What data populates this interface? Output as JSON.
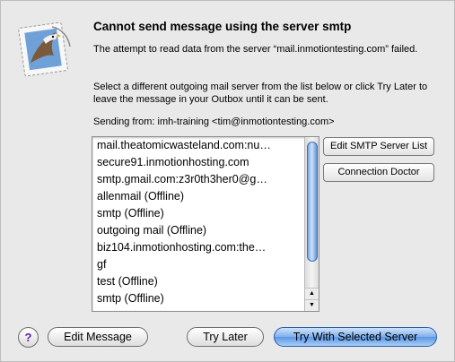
{
  "dialog": {
    "title": "Cannot send message using the server smtp",
    "paragraph1": "The attempt to read data from the server “mail.inmotiontesting.com” failed.",
    "paragraph2": "Select a different outgoing mail server from the list below or click Try Later to leave the message in your Outbox until it can be sent.",
    "sending_from": "Sending from: imh-training <tim@inmotiontesting.com>"
  },
  "servers": [
    "mail.theatomicwasteland.com:nu…",
    "secure91.inmotionhosting.com",
    "smtp.gmail.com:z3r0th3her0@g…",
    "allenmail (Offline)",
    "smtp (Offline)",
    "outgoing mail (Offline)",
    "biz104.inmotionhosting.com:the…",
    "gf",
    "test (Offline)",
    "smtp (Offline)"
  ],
  "side_buttons": {
    "edit_smtp": "Edit SMTP Server List",
    "connection_doctor": "Connection Doctor"
  },
  "bottom_buttons": {
    "help": "?",
    "edit_message": "Edit Message",
    "try_later": "Try Later",
    "try_selected": "Try With Selected Server"
  },
  "scroll": {
    "up_arrow": "▲",
    "down_arrow": "▼"
  },
  "icon": "mail-stamp-eagle-icon",
  "colors": {
    "default_button_blue": "#5b97e4",
    "help_glyph": "#5b2a9e"
  }
}
